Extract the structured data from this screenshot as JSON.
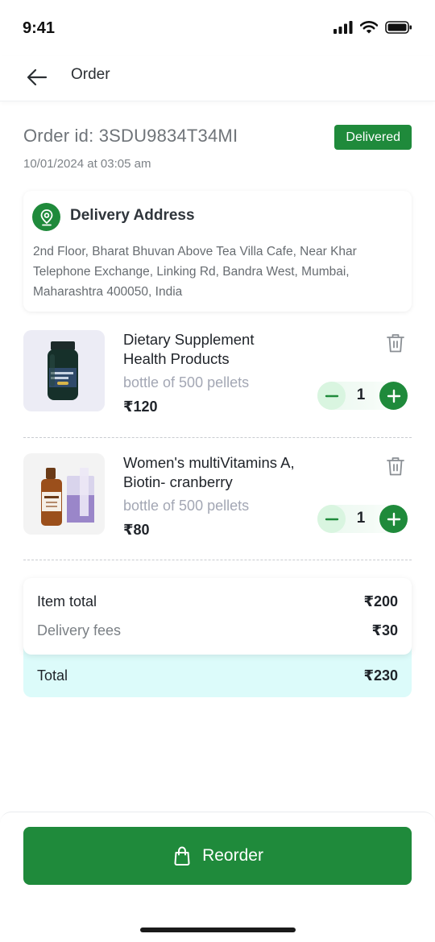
{
  "status_bar": {
    "time": "9:41",
    "icons": [
      "cellular-signal-icon",
      "wifi-icon",
      "battery-icon"
    ]
  },
  "header": {
    "title": "Order",
    "back_icon": "arrow-left-icon"
  },
  "order": {
    "id_text": "Order id: 3SDU9834T34MI",
    "date_text": "10/01/2024 at 03:05 am",
    "status": "Delivered"
  },
  "address": {
    "icon": "location-pin-icon",
    "title": "Delivery Address",
    "text": "2nd Floor, Bharat Bhuvan Above Tea Villa Cafe, Near Khar Telephone Exchange, Linking Rd, Bandra West, Mumbai, Maharashtra 400050, India"
  },
  "products": [
    {
      "name": "Dietary Supplement Health Products",
      "pack": "bottle of 500 pellets",
      "price": "₹120",
      "quantity": "1"
    },
    {
      "name": "Women's multiVitamins A, Biotin- cranberry",
      "pack": "bottle of 500 pellets",
      "price": "₹80",
      "quantity": "1"
    }
  ],
  "summary": {
    "item_total_label": "Item total",
    "item_total_value": "₹200",
    "delivery_label": "Delivery fees",
    "delivery_value": "₹30",
    "total_label": "Total",
    "total_value": "₹230"
  },
  "footer": {
    "reorder_label": "Reorder",
    "reorder_icon": "shopping-bag-icon"
  },
  "colors": {
    "primary_green": "#1f8a3b",
    "qty_minus_bg": "#d9f5e0",
    "total_row_bg": "#dcfbfa",
    "muted_text": "#a3a7b4"
  }
}
